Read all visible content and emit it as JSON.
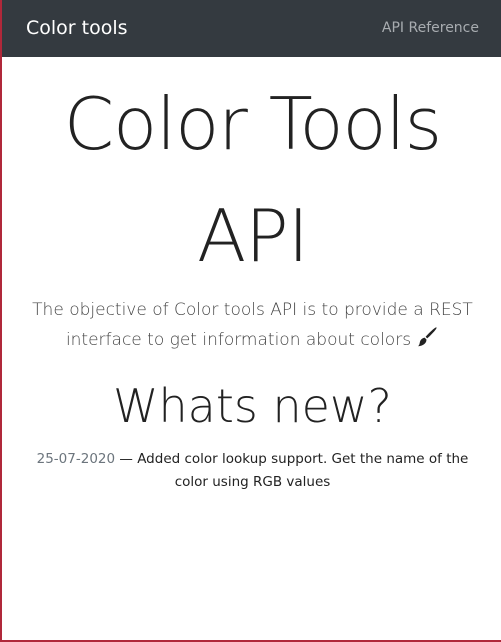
{
  "navbar": {
    "brand": "Color tools",
    "link": "API Reference"
  },
  "hero": {
    "title_line1": "Color Tools",
    "title_line2": "API",
    "tagline": "The objective of Color tools API is to provide a REST interface to get information about colors",
    "tagline_icon": "paintbrush-icon"
  },
  "whats_new": {
    "heading": "Whats new?",
    "items": [
      {
        "date": "25-07-2020",
        "separator": " — ",
        "text": "Added color lookup support. Get the name of the color using RGB values"
      }
    ]
  },
  "colors": {
    "navbar_bg": "#343a40",
    "brand_text": "#ffffff",
    "nav_link_text": "#a8acb0",
    "date_text": "#6c757d",
    "body_text": "#222222"
  }
}
